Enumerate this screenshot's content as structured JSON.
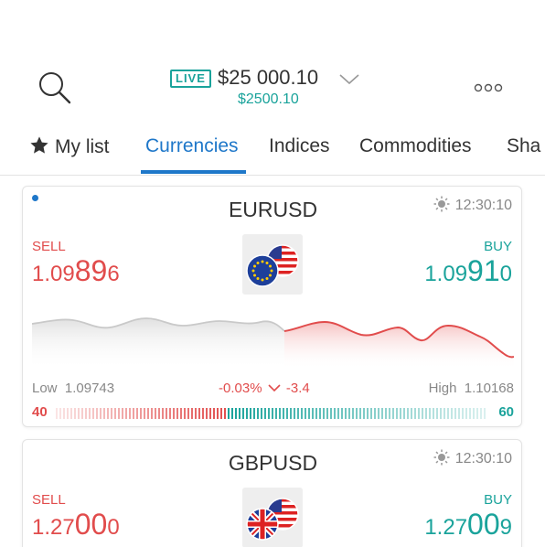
{
  "header": {
    "live_badge": "LIVE",
    "balance": "$25 000.10",
    "sub_balance": "$2500.10"
  },
  "tabs": [
    {
      "label": "My list",
      "icon": "star-icon"
    },
    {
      "label": "Currencies",
      "active": true
    },
    {
      "label": "Indices"
    },
    {
      "label": "Commodities"
    },
    {
      "label": "Sha"
    }
  ],
  "colors": {
    "accent": "#1e77c9",
    "sell": "#e14c4c",
    "buy": "#1aa39b"
  },
  "instruments": [
    {
      "pair": "EURUSD",
      "time": "12:30:10",
      "sell_label": "SELL",
      "sell_prefix": "1.09",
      "sell_big": "89",
      "sell_suffix": "6",
      "buy_label": "BUY",
      "buy_prefix": "1.09",
      "buy_big": "91",
      "buy_suffix": "0",
      "low_label": "Low",
      "low_value": "1.09743",
      "change_pct": "-0.03%",
      "change_value": "-3.4",
      "high_label": "High",
      "high_value": "1.10168",
      "sentiment_sell": "40",
      "sentiment_buy": "60",
      "flags": [
        "eu-flag-icon",
        "us-flag-icon"
      ]
    },
    {
      "pair": "GBPUSD",
      "time": "12:30:10",
      "sell_label": "SELL",
      "sell_prefix": "1.27",
      "sell_big": "00",
      "sell_suffix": "0",
      "buy_label": "BUY",
      "buy_prefix": "1.27",
      "buy_big": "00",
      "buy_suffix": "9",
      "flags": [
        "uk-flag-icon",
        "us-flag-icon"
      ]
    }
  ]
}
